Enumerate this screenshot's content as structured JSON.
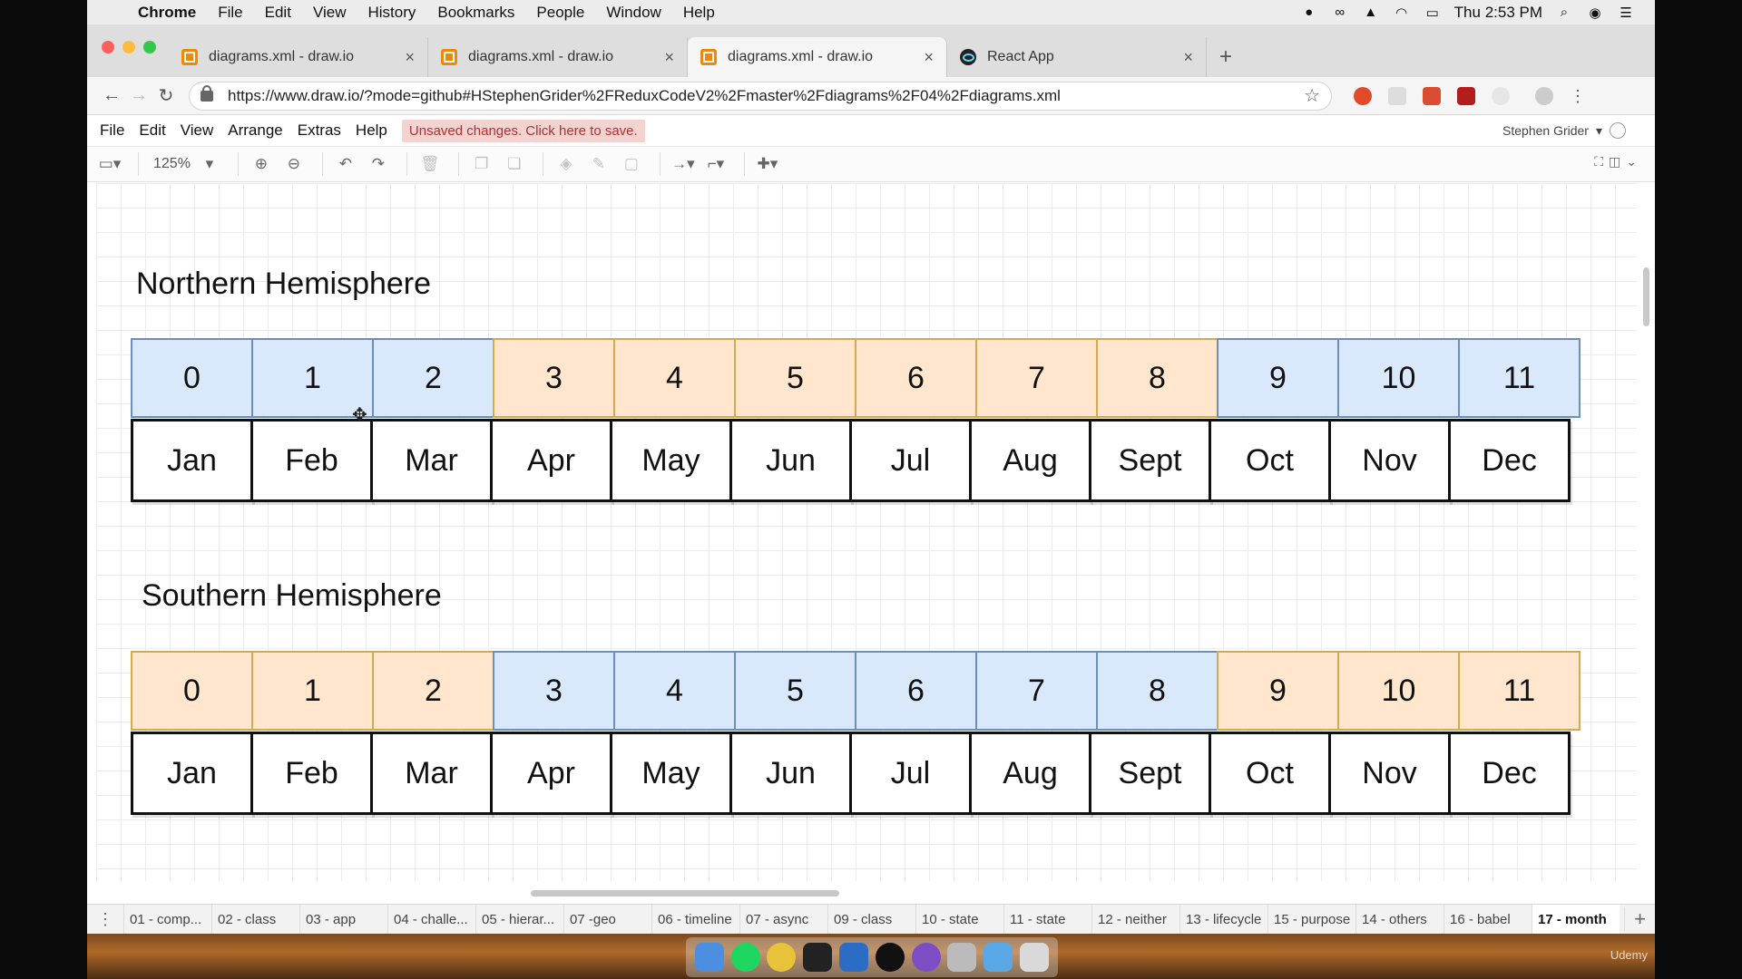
{
  "menubar": {
    "app": "Chrome",
    "items": [
      "File",
      "Edit",
      "View",
      "History",
      "Bookmarks",
      "People",
      "Window",
      "Help"
    ],
    "clock": "Thu 2:53 PM"
  },
  "browser": {
    "tabs": [
      {
        "title": "diagrams.xml - draw.io",
        "active": false
      },
      {
        "title": "diagrams.xml - draw.io",
        "active": false
      },
      {
        "title": "diagrams.xml - draw.io",
        "active": true
      },
      {
        "title": "React App",
        "active": false
      }
    ],
    "url": "https://www.draw.io/?mode=github#HStephenGrider%2FReduxCodeV2%2Fmaster%2Fdiagrams%2F04%2Fdiagrams.xml"
  },
  "drawio": {
    "menus": [
      "File",
      "Edit",
      "View",
      "Arrange",
      "Extras",
      "Help"
    ],
    "unsaved": "Unsaved changes. Click here to save.",
    "user": "Stephen Grider",
    "zoom": "125%",
    "colors": {
      "blue_fill": "#dae8fc",
      "blue_stroke": "#6c8ebf",
      "orange_fill": "#ffe6cc",
      "orange_stroke": "#d6a84f"
    }
  },
  "diagram": {
    "northern": {
      "title": "Northern Hemisphere",
      "numbers": [
        "0",
        "1",
        "2",
        "3",
        "4",
        "5",
        "6",
        "7",
        "8",
        "9",
        "10",
        "11"
      ],
      "colors": [
        "blue",
        "blue",
        "blue",
        "orange",
        "orange",
        "orange",
        "orange",
        "orange",
        "orange",
        "blue",
        "blue",
        "blue"
      ],
      "months": [
        "Jan",
        "Feb",
        "Mar",
        "Apr",
        "May",
        "Jun",
        "Jul",
        "Aug",
        "Sept",
        "Oct",
        "Nov",
        "Dec"
      ]
    },
    "southern": {
      "title": "Southern Hemisphere",
      "numbers": [
        "0",
        "1",
        "2",
        "3",
        "4",
        "5",
        "6",
        "7",
        "8",
        "9",
        "10",
        "11"
      ],
      "colors": [
        "orange",
        "orange",
        "orange",
        "blue",
        "blue",
        "blue",
        "blue",
        "blue",
        "blue",
        "orange",
        "orange",
        "orange"
      ],
      "months": [
        "Jan",
        "Feb",
        "Mar",
        "Apr",
        "May",
        "Jun",
        "Jul",
        "Aug",
        "Sept",
        "Oct",
        "Nov",
        "Dec"
      ]
    }
  },
  "pages": [
    "01 - comp...",
    "02 - class",
    "03 - app",
    "04 - challe...",
    "05 - hierar...",
    "07 -geo",
    "06 - timeline",
    "07 - async",
    "09 - class",
    "10 - state",
    "11 - state",
    "12 - neither",
    "13 - lifecycle",
    "15 - purpose",
    "14 - others",
    "16 - babel",
    "17 - month"
  ],
  "active_page": "17 - month",
  "watermark": "Udemy"
}
